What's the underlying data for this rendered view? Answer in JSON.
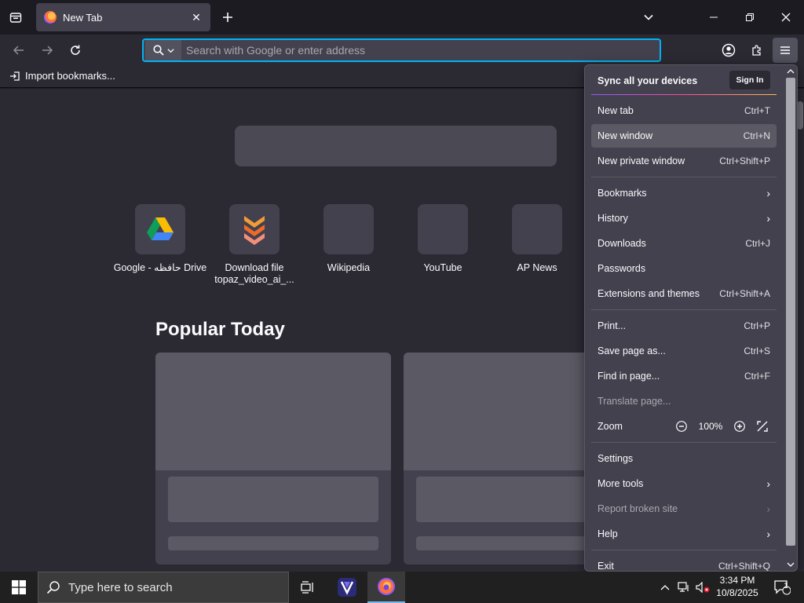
{
  "tab": {
    "title": "New Tab"
  },
  "urlbar": {
    "placeholder": "Search with Google or enter address"
  },
  "bookmarks": {
    "import_label": "Import bookmarks..."
  },
  "shortcuts": [
    {
      "label": "Google - حافظه Drive",
      "icon": "google-drive-icon"
    },
    {
      "label": "Download file topaz_video_ai_...",
      "icon": "download-chevrons-icon"
    },
    {
      "label": "Wikipedia",
      "icon": ""
    },
    {
      "label": "YouTube",
      "icon": ""
    },
    {
      "label": "AP News",
      "icon": ""
    }
  ],
  "popular": {
    "heading": "Popular Today"
  },
  "menu": {
    "sync_text": "Sync all your devices",
    "sign_in": "Sign In",
    "items": [
      {
        "label": "New tab",
        "shortcut": "Ctrl+T"
      },
      {
        "label": "New window",
        "shortcut": "Ctrl+N"
      },
      {
        "label": "New private window",
        "shortcut": "Ctrl+Shift+P"
      },
      {
        "label": "Bookmarks",
        "shortcut": ""
      },
      {
        "label": "History",
        "shortcut": ""
      },
      {
        "label": "Downloads",
        "shortcut": "Ctrl+J"
      },
      {
        "label": "Passwords",
        "shortcut": ""
      },
      {
        "label": "Extensions and themes",
        "shortcut": "Ctrl+Shift+A"
      },
      {
        "label": "Print...",
        "shortcut": "Ctrl+P"
      },
      {
        "label": "Save page as...",
        "shortcut": "Ctrl+S"
      },
      {
        "label": "Find in page...",
        "shortcut": "Ctrl+F"
      },
      {
        "label": "Translate page...",
        "shortcut": ""
      },
      {
        "label": "Zoom",
        "shortcut": ""
      },
      {
        "label": "Settings",
        "shortcut": ""
      },
      {
        "label": "More tools",
        "shortcut": ""
      },
      {
        "label": "Report broken site",
        "shortcut": ""
      },
      {
        "label": "Help",
        "shortcut": ""
      },
      {
        "label": "Exit",
        "shortcut": "Ctrl+Shift+Q"
      }
    ],
    "zoom_value": "100%"
  },
  "taskbar": {
    "search_placeholder": "Type here to search",
    "time": "3:34 PM",
    "date": "10/8/2025",
    "notification_count": "1"
  },
  "colors": {
    "accent": "#00b3f4",
    "menu_bg": "#42414d",
    "page_bg": "#2b2a33"
  }
}
